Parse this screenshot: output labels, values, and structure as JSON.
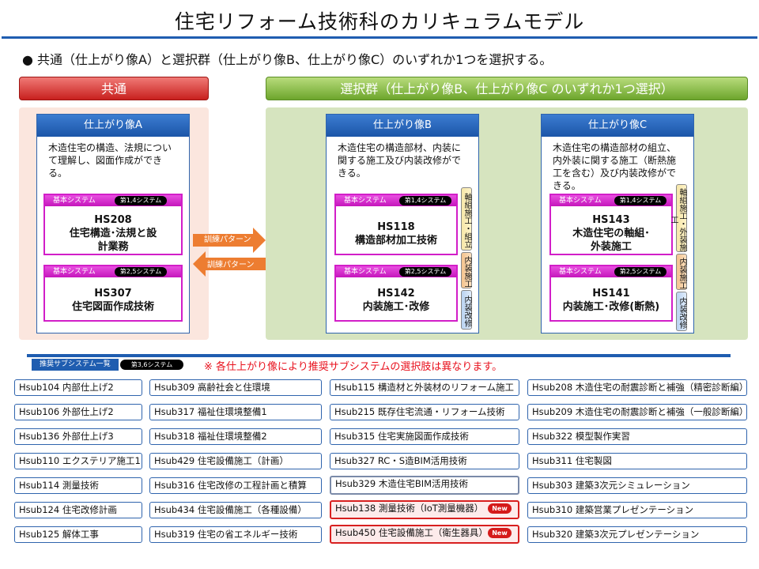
{
  "title": "住宅リフォーム技術科のカリキュラムモデル",
  "instruction": "● 共通（仕上がり像A）と選択群（仕上がり像B、仕上がり像C）のいずれか1つを選択する。",
  "common_header": "共通",
  "select_header": "選択群（仕上がり像B、仕上がり像C のいずれか1つ選択）",
  "training_pattern": "訓練パターン",
  "system_label": "基本システム",
  "paths": {
    "a": {
      "title": "仕上がり像A",
      "desc": "木造住宅の構造、法規について理解し、図面作成ができる。",
      "sys1": {
        "pill": "第1,4システム",
        "code": "HS208",
        "name": "住宅構造･法規と設計業務"
      },
      "sys2": {
        "pill": "第2,5システム",
        "code": "HS307",
        "name": "住宅図面作成技術"
      }
    },
    "b": {
      "title": "仕上がり像B",
      "desc": "木造住宅の構造部材、内装に関する施工及び内装改修ができる。",
      "sys1": {
        "pill": "第1,4システム",
        "code": "HS118",
        "name": "構造部材加工技術"
      },
      "sys2": {
        "pill": "第2,5システム",
        "code": "HS142",
        "name": "内装施工･改修"
      },
      "tags": [
        "軸組施工・組立",
        "内装施工",
        "内装改修"
      ]
    },
    "c": {
      "title": "仕上がり像C",
      "desc": "木造住宅の構造部材の組立、内外装に関する施工（断熱施工を含む）及び内装改修ができる。",
      "sys1": {
        "pill": "第1,4システム",
        "code": "HS143",
        "name": "木造住宅の軸組･外装施工"
      },
      "sys2": {
        "pill": "第2,5システム",
        "code": "HS141",
        "name": "内装施工･改修(断熱)"
      },
      "tags": [
        "軸組施工・外装施工",
        "内装施工",
        "内装改修"
      ]
    }
  },
  "recommended": {
    "label": "推奨サブシステム一覧",
    "pill": "第3,6システム",
    "note": "※ 各仕上がり像により推奨サブシステムの選択肢は異なります。",
    "new_badge": "New",
    "col1": [
      "Hsub104 内部仕上げ2",
      "Hsub106 外部仕上げ2",
      "Hsub136 外部仕上げ3",
      "Hsub110 エクステリア施工1",
      "Hsub114 測量技術",
      "Hsub124 住宅改修計画",
      "Hsub125 解体工事"
    ],
    "col2": [
      "Hsub309 高齢社会と住環境",
      "Hsub317 福祉住環境整備1",
      "Hsub318 福祉住環境整備2",
      "Hsub429 住宅設備施工（計画）",
      "Hsub316 住宅改修の工程計画と積算",
      "Hsub434 住宅設備施工（各種設備）",
      "Hsub319 住宅の省エネルギー技術"
    ],
    "col3": [
      "Hsub115 構造材と外装材のリフォーム施工",
      "Hsub215 既存住宅流通・リフォーム技術",
      "Hsub315 住宅実施図面作成技術",
      "Hsub327 RC・S造BIM活用技術",
      "Hsub329 木造住宅BIM活用技術",
      "Hsub138 測量技術（IoT測量機器）",
      "Hsub450 住宅設備施工（衛生器具）"
    ],
    "col4": [
      "Hsub208 木造住宅の耐震診断と補強（精密診断編）",
      "Hsub209 木造住宅の耐震診断と補強（一般診断編）",
      "Hsub322 模型製作実習",
      "Hsub311 住宅製図",
      "Hsub303 建築3次元シミュレーション",
      "Hsub310 建築営業プレゼンテーション",
      "Hsub320 建築3次元プレゼンテーション"
    ]
  }
}
